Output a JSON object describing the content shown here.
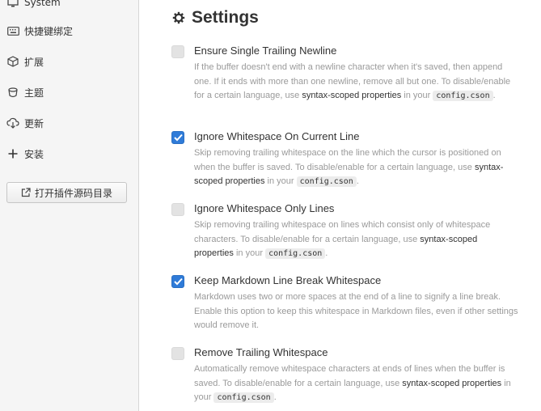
{
  "sidebar": {
    "items": [
      {
        "label": "System",
        "icon": "monitor-icon"
      },
      {
        "label": "快捷键绑定",
        "icon": "keyboard-icon"
      },
      {
        "label": "扩展",
        "icon": "package-icon"
      },
      {
        "label": "主题",
        "icon": "paintcan-icon"
      },
      {
        "label": "更新",
        "icon": "cloud-download-icon"
      },
      {
        "label": "安装",
        "icon": "plus-icon"
      }
    ],
    "open_source_button": "打开插件源码目录"
  },
  "main": {
    "title": "Settings",
    "settings": [
      {
        "title": "Ensure Single Trailing Newline",
        "checked": false,
        "desc_prefix": "If the buffer doesn't end with a newline character when it's saved, then append one. If it ends with more than one newline, remove all but one. To disable/enable for a certain language, use ",
        "desc_link": "syntax-scoped properties",
        "desc_mid": " in your ",
        "desc_code": "config.cson",
        "desc_suffix": "."
      },
      {
        "title": "Ignore Whitespace On Current Line",
        "checked": true,
        "desc_prefix": "Skip removing trailing whitespace on the line which the cursor is positioned on when the buffer is saved. To disable/enable for a certain language, use ",
        "desc_link": "syntax-scoped properties",
        "desc_mid": " in your ",
        "desc_code": "config.cson",
        "desc_suffix": "."
      },
      {
        "title": "Ignore Whitespace Only Lines",
        "checked": false,
        "desc_prefix": "Skip removing trailing whitespace on lines which consist only of whitespace characters. To disable/enable for a certain language, use ",
        "desc_link": "syntax-scoped properties",
        "desc_mid": " in your ",
        "desc_code": "config.cson",
        "desc_suffix": "."
      },
      {
        "title": "Keep Markdown Line Break Whitespace",
        "checked": true,
        "desc_prefix": "Markdown uses two or more spaces at the end of a line to signify a line break. Enable this option to keep this whitespace in Markdown files, even if other settings would remove it."
      },
      {
        "title": "Remove Trailing Whitespace",
        "checked": false,
        "desc_prefix": "Automatically remove whitespace characters at ends of lines when the buffer is saved. To disable/enable for a certain language, use ",
        "desc_link": "syntax-scoped properties",
        "desc_mid": " in your ",
        "desc_code": "config.cson",
        "desc_suffix": "."
      }
    ]
  },
  "colors": {
    "accent": "#2f7bd8",
    "sidebar_bg": "#f5f5f5",
    "muted_text": "#9a9a9a"
  }
}
